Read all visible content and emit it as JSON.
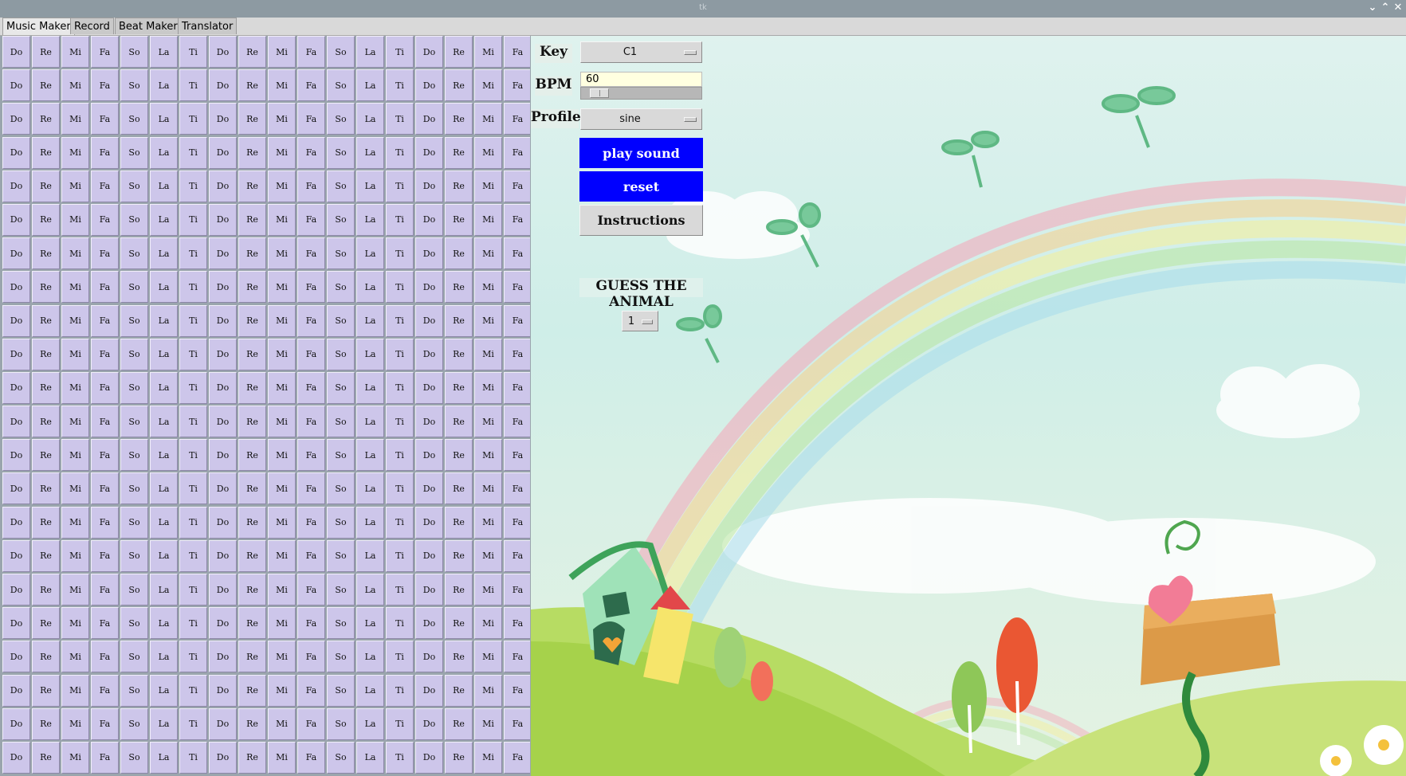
{
  "window": {
    "title": "tk",
    "controls": {
      "minimize": "⌄",
      "maximize": "⌃",
      "close": "✕"
    }
  },
  "tabs": [
    {
      "label": "Music Maker",
      "active": true
    },
    {
      "label": "Record",
      "active": false
    },
    {
      "label": "Beat Maker",
      "active": false
    },
    {
      "label": "Translator",
      "active": false
    }
  ],
  "grid": {
    "rows": 22,
    "notes": [
      "Do",
      "Re",
      "Mi",
      "Fa",
      "So",
      "La",
      "Ti",
      "Do",
      "Re",
      "Mi",
      "Fa",
      "So",
      "La",
      "Ti",
      "Do",
      "Re",
      "Mi",
      "Fa"
    ]
  },
  "controls": {
    "key_label": "Key",
    "key_value": "C1",
    "bpm_label": "BPM",
    "bpm_value": "60",
    "bpm_level_fraction": 0.08,
    "profile_label": "Profile",
    "profile_value": "sine",
    "play_label": "play sound",
    "reset_label": "reset",
    "instructions_label": "Instructions",
    "guess_label": "GUESS THE ANIMAL",
    "guess_value": "1"
  },
  "colors": {
    "grid_cell": "#cdc6ea",
    "button_blue": "#0000ff",
    "entry_bg": "#ffffe0"
  }
}
